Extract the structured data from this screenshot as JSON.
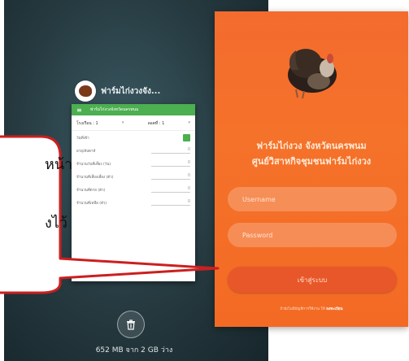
{
  "recents": {
    "app_name": "ฟาร์มไก่งวงจัง...",
    "toolbar_title": "ฟาร์มไก่งวงจังหวัดนครพนม",
    "menu_icon": "≡",
    "select_house": "โรงเรือน : 1",
    "select_batch": "ลอตที่ : 1",
    "form_rows": [
      {
        "label": "วันที่เข้า",
        "value": ""
      },
      {
        "label": "อายุ/สัปดาห์",
        "value": "0"
      },
      {
        "label": "จำนวนวันที่เลี้ยง (วัน)",
        "value": "0"
      },
      {
        "label": "จำนวนที่เลี้ยงเลี้ยง (ตัว)",
        "value": "0"
      },
      {
        "label": "จำนวนที่ตาย (ตัว)",
        "value": "0"
      },
      {
        "label": "จำนวนที่เหลือ (ตัว)",
        "value": "0"
      }
    ],
    "memory_text": "652 MB จาก 2 GB ว่าง",
    "trash_icon": "trash-icon"
  },
  "login": {
    "title_line1": "ฟาร์มไก่งวง จังหวัดนครพนม",
    "title_line2": "ศูนย์วิสาหกิจชุมชนฟาร์มไก่งวง",
    "username_placeholder": "Username",
    "password_placeholder": "Password",
    "login_button": "เข้าสู่ระบบ",
    "footnote_text": "ถ้ายังไม่มีบัญชีการใช้งาน ให้",
    "footnote_link": "ลงทะเบียน"
  },
  "callout": {
    "line1": "หน้า",
    "line2": "งไว้"
  },
  "colors": {
    "login_bg": "#f46b2e",
    "toolbar_green": "#4caf50"
  }
}
